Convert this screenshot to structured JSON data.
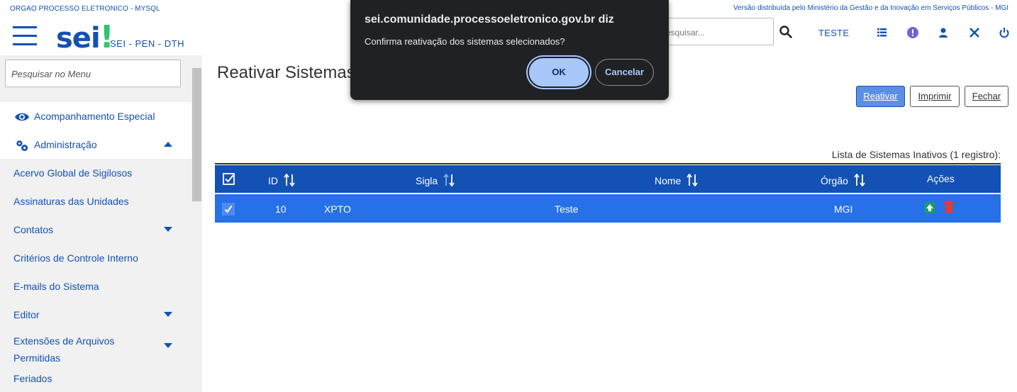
{
  "header": {
    "org_name": "ORGAO PROCESSO ELETRONICO - MYSQL",
    "gov_note": "Versão distribuída pelo Ministério da Gestão e da Inovação em Serviços Públicos - MGI",
    "logo_text": "sei",
    "logo_bang": "!",
    "sub_title": "SEI - PEN - DTH",
    "search_placeholder": "Pesquisar...",
    "unit_label": "TESTE",
    "icons": [
      "menu-icon",
      "search-icon",
      "list-icon",
      "alert-icon",
      "user-icon",
      "tools-icon",
      "power-icon"
    ]
  },
  "sidebar": {
    "search_placeholder": "Pesquisar no Menu",
    "top_items": [
      {
        "label": "Acompanhamento Especial",
        "icon": "eye-icon"
      },
      {
        "label": "Administração",
        "icon": "gears-icon"
      }
    ],
    "items": [
      {
        "label": "Acervo Global de Sigilosos"
      },
      {
        "label": "Assinaturas das Unidades"
      },
      {
        "label": "Contatos"
      },
      {
        "label": "Critérios de Controle Interno"
      },
      {
        "label": "E-mails do Sistema"
      },
      {
        "label": "Editor"
      },
      {
        "label": "Extensões de Arquivos Permitidas"
      },
      {
        "label": "Feriados"
      }
    ]
  },
  "main": {
    "title": "Reativar Sistemas",
    "buttons": {
      "reactivate": "Reativar",
      "print": "Imprimir",
      "close": "Fechar"
    },
    "table_caption": "Lista de Sistemas Inativos (1 registro):",
    "columns": [
      "ID",
      "Sigla",
      "Nome",
      "Órgão",
      "Ações"
    ],
    "rows": [
      {
        "id": "10",
        "sigla": "XPTO",
        "nome": "Teste",
        "orgao": "MGI",
        "checked": true
      }
    ]
  },
  "dialog": {
    "title": "sei.comunidade.processoeletronico.gov.br diz",
    "message": "Confirma reativação dos sistemas selecionados?",
    "ok": "OK",
    "cancel": "Cancelar"
  },
  "colors": {
    "primary": "#1351b4",
    "row_selected": "#2670e8",
    "logo_accent": "#2dc66b",
    "dialog_bg": "#202124",
    "dialog_button": "#a8c7fa"
  }
}
